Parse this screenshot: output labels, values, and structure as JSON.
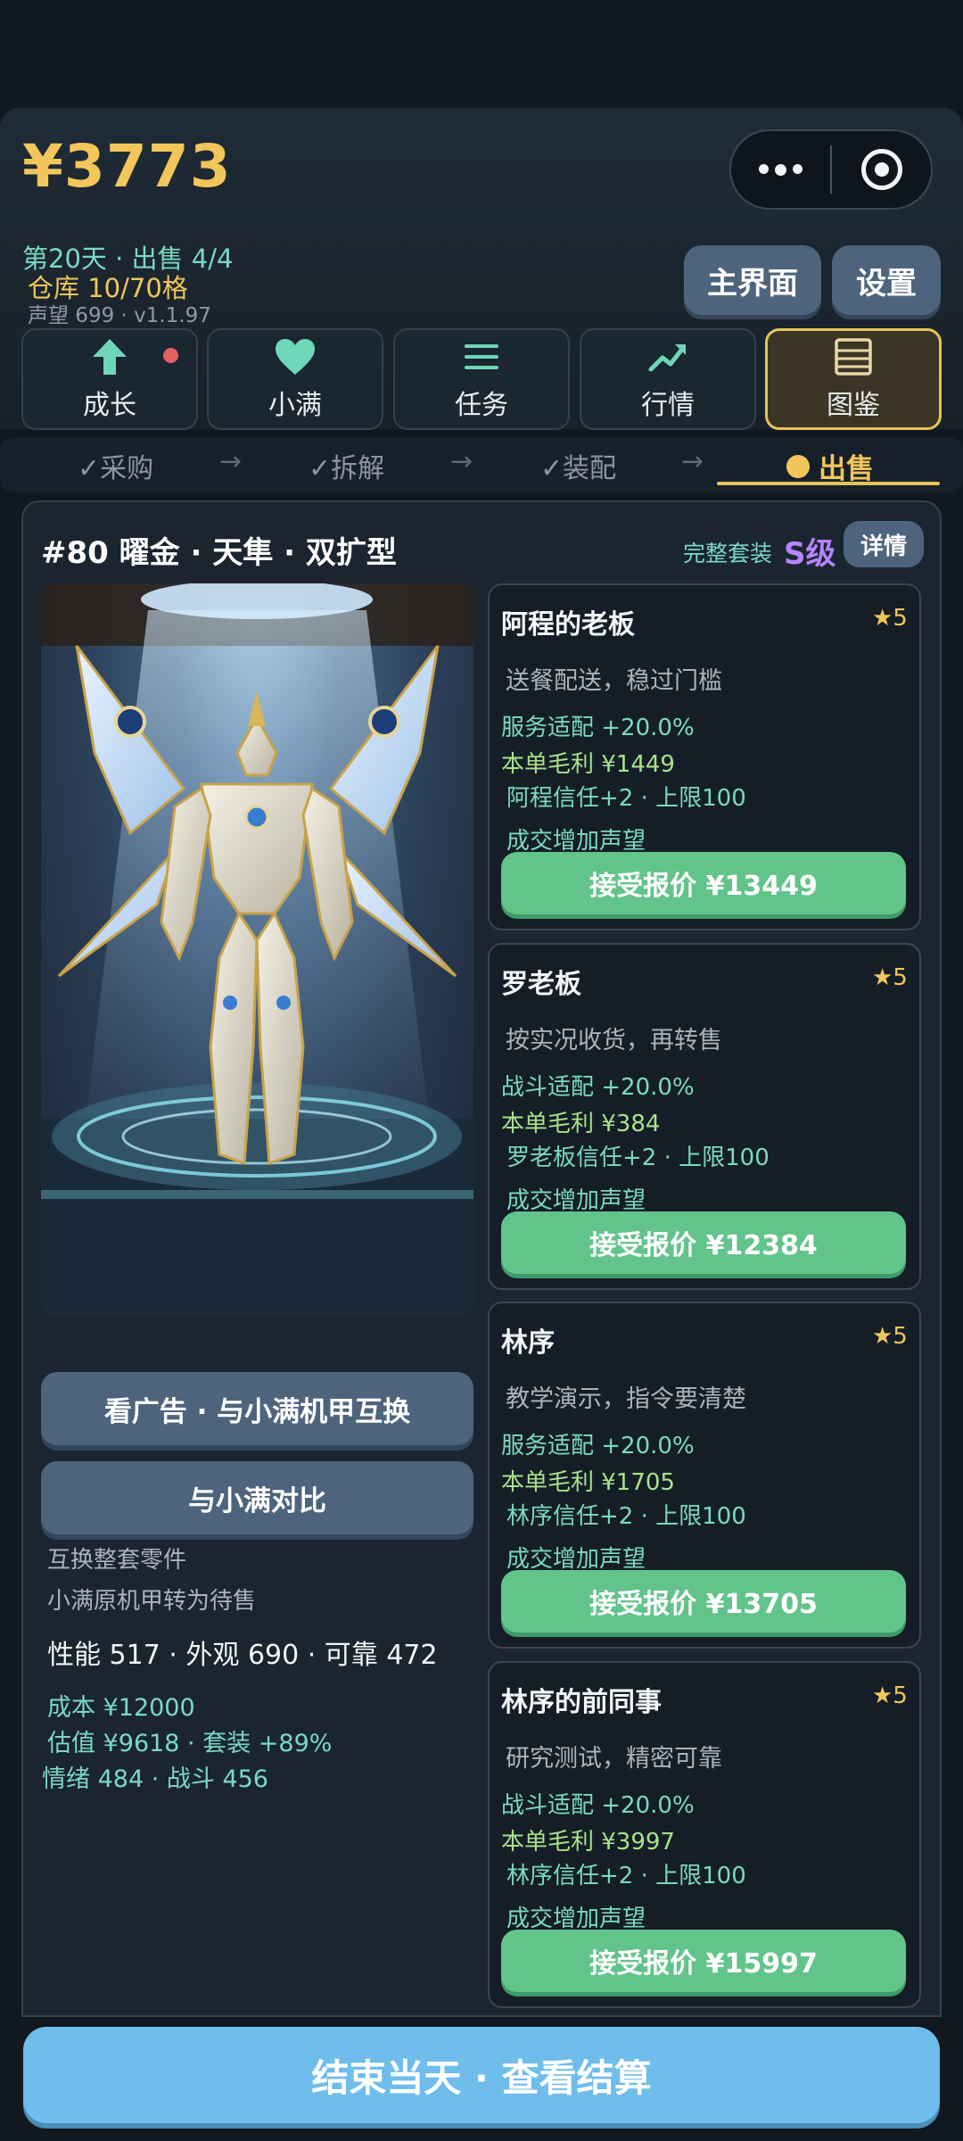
{
  "header": {
    "money": "¥3773",
    "day_sale": "第20天 · 出售 4/4",
    "warehouse": "仓库 10/70格",
    "reputation_version": "声望 699 · v1.1.97",
    "main_menu": "主界面",
    "settings": "设置"
  },
  "nav": [
    {
      "label": "成长",
      "icon": "arrow-up-icon"
    },
    {
      "label": "小满",
      "icon": "heart-icon"
    },
    {
      "label": "任务",
      "icon": "list-icon"
    },
    {
      "label": "行情",
      "icon": "trend-icon"
    },
    {
      "label": "图鉴",
      "icon": "book-icon"
    }
  ],
  "steps": {
    "s1": "✓采购",
    "s2": "✓拆解",
    "s3": "✓装配",
    "s4": "出售",
    "arrow": "→"
  },
  "robot": {
    "title": "#80 曜金 · 天隼 · 双扩型",
    "set_label": "完整套装",
    "grade": "S级",
    "detail": "详情",
    "swap_ad": "看广告 · 与小满机甲互换",
    "compare": "与小满对比",
    "swap_note1": "互换整套零件",
    "swap_note2": "小满原机甲转为待售",
    "stats": "性能 517 · 外观 690 · 可靠 472",
    "cost": "成本 ¥12000",
    "valuation": "估值 ¥9618 · 套装 +89%",
    "emotion_combat": "情绪 484 · 战斗 456"
  },
  "offers": [
    {
      "name": "阿程的老板",
      "star": "★5",
      "desc": "送餐配送，稳过门槛",
      "fit": "服务适配 +20.0%",
      "profit": "本单毛利 ¥1449",
      "trust": "阿程信任+2 · 上限100",
      "rep": "成交增加声望",
      "accept": "接受报价 ¥13449"
    },
    {
      "name": "罗老板",
      "star": "★5",
      "desc": "按实况收货，再转售",
      "fit": "战斗适配 +20.0%",
      "profit": "本单毛利 ¥384",
      "trust": "罗老板信任+2 · 上限100",
      "rep": "成交增加声望",
      "accept": "接受报价 ¥12384"
    },
    {
      "name": "林序",
      "star": "★5",
      "desc": "教学演示，指令要清楚",
      "fit": "服务适配 +20.0%",
      "profit": "本单毛利 ¥1705",
      "trust": "林序信任+2 · 上限100",
      "rep": "成交增加声望",
      "accept": "接受报价 ¥13705"
    },
    {
      "name": "林序的前同事",
      "star": "★5",
      "desc": "研究测试，精密可靠",
      "fit": "战斗适配 +20.0%",
      "profit": "本单毛利 ¥3997",
      "trust": "林序信任+2 · 上限100",
      "rep": "成交增加声望",
      "accept": "接受报价 ¥15997"
    }
  ],
  "footer": {
    "end_day": "结束当天 · 查看结算"
  },
  "colors": {
    "gold": "#f2c65a",
    "teal": "#7ad8c4",
    "green_button": "#63c48b",
    "blue_button": "#6fbdeb",
    "grade_purple": "#b385ff"
  }
}
